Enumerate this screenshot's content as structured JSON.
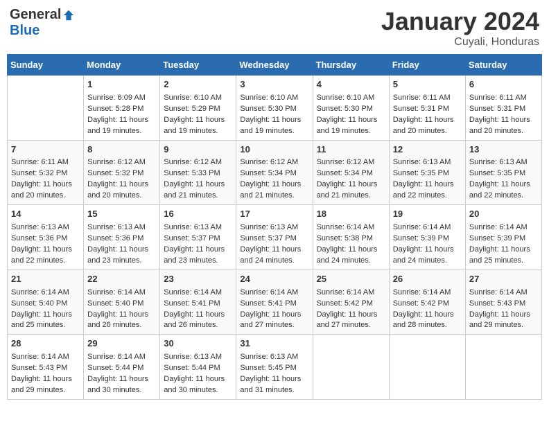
{
  "header": {
    "logo_general": "General",
    "logo_blue": "Blue",
    "month_title": "January 2024",
    "location": "Cuyali, Honduras"
  },
  "weekdays": [
    "Sunday",
    "Monday",
    "Tuesday",
    "Wednesday",
    "Thursday",
    "Friday",
    "Saturday"
  ],
  "weeks": [
    [
      {
        "day": "",
        "sunrise": "",
        "sunset": "",
        "daylight": ""
      },
      {
        "day": "1",
        "sunrise": "Sunrise: 6:09 AM",
        "sunset": "Sunset: 5:28 PM",
        "daylight": "Daylight: 11 hours and 19 minutes."
      },
      {
        "day": "2",
        "sunrise": "Sunrise: 6:10 AM",
        "sunset": "Sunset: 5:29 PM",
        "daylight": "Daylight: 11 hours and 19 minutes."
      },
      {
        "day": "3",
        "sunrise": "Sunrise: 6:10 AM",
        "sunset": "Sunset: 5:30 PM",
        "daylight": "Daylight: 11 hours and 19 minutes."
      },
      {
        "day": "4",
        "sunrise": "Sunrise: 6:10 AM",
        "sunset": "Sunset: 5:30 PM",
        "daylight": "Daylight: 11 hours and 19 minutes."
      },
      {
        "day": "5",
        "sunrise": "Sunrise: 6:11 AM",
        "sunset": "Sunset: 5:31 PM",
        "daylight": "Daylight: 11 hours and 20 minutes."
      },
      {
        "day": "6",
        "sunrise": "Sunrise: 6:11 AM",
        "sunset": "Sunset: 5:31 PM",
        "daylight": "Daylight: 11 hours and 20 minutes."
      }
    ],
    [
      {
        "day": "7",
        "sunrise": "Sunrise: 6:11 AM",
        "sunset": "Sunset: 5:32 PM",
        "daylight": "Daylight: 11 hours and 20 minutes."
      },
      {
        "day": "8",
        "sunrise": "Sunrise: 6:12 AM",
        "sunset": "Sunset: 5:32 PM",
        "daylight": "Daylight: 11 hours and 20 minutes."
      },
      {
        "day": "9",
        "sunrise": "Sunrise: 6:12 AM",
        "sunset": "Sunset: 5:33 PM",
        "daylight": "Daylight: 11 hours and 21 minutes."
      },
      {
        "day": "10",
        "sunrise": "Sunrise: 6:12 AM",
        "sunset": "Sunset: 5:34 PM",
        "daylight": "Daylight: 11 hours and 21 minutes."
      },
      {
        "day": "11",
        "sunrise": "Sunrise: 6:12 AM",
        "sunset": "Sunset: 5:34 PM",
        "daylight": "Daylight: 11 hours and 21 minutes."
      },
      {
        "day": "12",
        "sunrise": "Sunrise: 6:13 AM",
        "sunset": "Sunset: 5:35 PM",
        "daylight": "Daylight: 11 hours and 22 minutes."
      },
      {
        "day": "13",
        "sunrise": "Sunrise: 6:13 AM",
        "sunset": "Sunset: 5:35 PM",
        "daylight": "Daylight: 11 hours and 22 minutes."
      }
    ],
    [
      {
        "day": "14",
        "sunrise": "Sunrise: 6:13 AM",
        "sunset": "Sunset: 5:36 PM",
        "daylight": "Daylight: 11 hours and 22 minutes."
      },
      {
        "day": "15",
        "sunrise": "Sunrise: 6:13 AM",
        "sunset": "Sunset: 5:36 PM",
        "daylight": "Daylight: 11 hours and 23 minutes."
      },
      {
        "day": "16",
        "sunrise": "Sunrise: 6:13 AM",
        "sunset": "Sunset: 5:37 PM",
        "daylight": "Daylight: 11 hours and 23 minutes."
      },
      {
        "day": "17",
        "sunrise": "Sunrise: 6:13 AM",
        "sunset": "Sunset: 5:37 PM",
        "daylight": "Daylight: 11 hours and 24 minutes."
      },
      {
        "day": "18",
        "sunrise": "Sunrise: 6:14 AM",
        "sunset": "Sunset: 5:38 PM",
        "daylight": "Daylight: 11 hours and 24 minutes."
      },
      {
        "day": "19",
        "sunrise": "Sunrise: 6:14 AM",
        "sunset": "Sunset: 5:39 PM",
        "daylight": "Daylight: 11 hours and 24 minutes."
      },
      {
        "day": "20",
        "sunrise": "Sunrise: 6:14 AM",
        "sunset": "Sunset: 5:39 PM",
        "daylight": "Daylight: 11 hours and 25 minutes."
      }
    ],
    [
      {
        "day": "21",
        "sunrise": "Sunrise: 6:14 AM",
        "sunset": "Sunset: 5:40 PM",
        "daylight": "Daylight: 11 hours and 25 minutes."
      },
      {
        "day": "22",
        "sunrise": "Sunrise: 6:14 AM",
        "sunset": "Sunset: 5:40 PM",
        "daylight": "Daylight: 11 hours and 26 minutes."
      },
      {
        "day": "23",
        "sunrise": "Sunrise: 6:14 AM",
        "sunset": "Sunset: 5:41 PM",
        "daylight": "Daylight: 11 hours and 26 minutes."
      },
      {
        "day": "24",
        "sunrise": "Sunrise: 6:14 AM",
        "sunset": "Sunset: 5:41 PM",
        "daylight": "Daylight: 11 hours and 27 minutes."
      },
      {
        "day": "25",
        "sunrise": "Sunrise: 6:14 AM",
        "sunset": "Sunset: 5:42 PM",
        "daylight": "Daylight: 11 hours and 27 minutes."
      },
      {
        "day": "26",
        "sunrise": "Sunrise: 6:14 AM",
        "sunset": "Sunset: 5:42 PM",
        "daylight": "Daylight: 11 hours and 28 minutes."
      },
      {
        "day": "27",
        "sunrise": "Sunrise: 6:14 AM",
        "sunset": "Sunset: 5:43 PM",
        "daylight": "Daylight: 11 hours and 29 minutes."
      }
    ],
    [
      {
        "day": "28",
        "sunrise": "Sunrise: 6:14 AM",
        "sunset": "Sunset: 5:43 PM",
        "daylight": "Daylight: 11 hours and 29 minutes."
      },
      {
        "day": "29",
        "sunrise": "Sunrise: 6:14 AM",
        "sunset": "Sunset: 5:44 PM",
        "daylight": "Daylight: 11 hours and 30 minutes."
      },
      {
        "day": "30",
        "sunrise": "Sunrise: 6:13 AM",
        "sunset": "Sunset: 5:44 PM",
        "daylight": "Daylight: 11 hours and 30 minutes."
      },
      {
        "day": "31",
        "sunrise": "Sunrise: 6:13 AM",
        "sunset": "Sunset: 5:45 PM",
        "daylight": "Daylight: 11 hours and 31 minutes."
      },
      {
        "day": "",
        "sunrise": "",
        "sunset": "",
        "daylight": ""
      },
      {
        "day": "",
        "sunrise": "",
        "sunset": "",
        "daylight": ""
      },
      {
        "day": "",
        "sunrise": "",
        "sunset": "",
        "daylight": ""
      }
    ]
  ]
}
